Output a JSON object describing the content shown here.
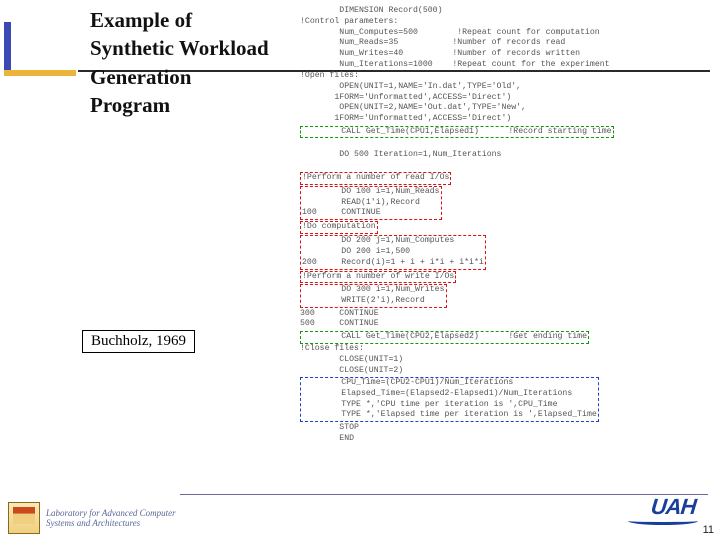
{
  "title": "Example of Synthetic Workload Generation Program",
  "citation": "Buchholz, 1969",
  "page_number": "11",
  "footer": {
    "lab_line1": "Laboratory for Advanced Computer",
    "lab_line2": "Systems and Architectures",
    "uah": "UAH"
  },
  "code": {
    "l01": "        DIMENSION Record(500)",
    "l02": "!Control parameters:",
    "l03a": "        Num_Computes=500",
    "l03b": "!Repeat count for computation",
    "l04a": "        Num_Reads=35",
    "l04b": "!Number of records read",
    "l05a": "        Num_Writes=40",
    "l05b": "!Number of records written",
    "l06a": "        Num_Iterations=1000",
    "l06b": "!Repeat count for the experiment",
    "l07": "!Open files:",
    "l08": "        OPEN(UNIT=1,NAME='In.dat',TYPE='Old',",
    "l09": "       1FORM='Unformatted',ACCESS='Direct')",
    "l10": "        OPEN(UNIT=2,NAME='Out.dat',TYPE='New',",
    "l11": "       1FORM='Unformatted',ACCESS='Direct')",
    "l12a": "        CALL Get_Time(CPU1,Elapsed1)",
    "l12b": "!Record starting time",
    "l13": "        DO 500 Iteration=1,Num_Iterations",
    "l14": "!Perform a number of read I/Os",
    "l15": "        DO 100 i=1,Num_Reads",
    "l16": "        READ(1'i),Record",
    "l17": "100     CONTINUE",
    "l18": "!Do computation",
    "l19": "        DO 200 j=1,Num_Computes",
    "l20": "        DO 200 i=1,500",
    "l21": "200     Record(i)=1 + i + i*i + i*i*i",
    "l22": "!Perform a number of write I/Os",
    "l23": "        DO 300 i=1,Num_Writes",
    "l24": "        WRITE(2'i),Record",
    "l25": "300     CONTINUE",
    "l26": "500     CONTINUE",
    "l27a": "        CALL Get_Time(CPU2,Elapsed2)",
    "l27b": "!Get ending time",
    "l28": "!Close files:",
    "l29": "        CLOSE(UNIT=1)",
    "l30": "        CLOSE(UNIT=2)",
    "l31": "        CPU_Time=(CPU2-CPU1)/Num_Iterations",
    "l32": "        Elapsed_Time=(Elapsed2-Elapsed1)/Num_Iterations",
    "l33": "        TYPE *,'CPU time per iteration is ',CPU_Time",
    "l34": "        TYPE *,'Elapsed time per iteration is ',Elapsed_Time",
    "l35": "        STOP",
    "l36": "        END"
  }
}
